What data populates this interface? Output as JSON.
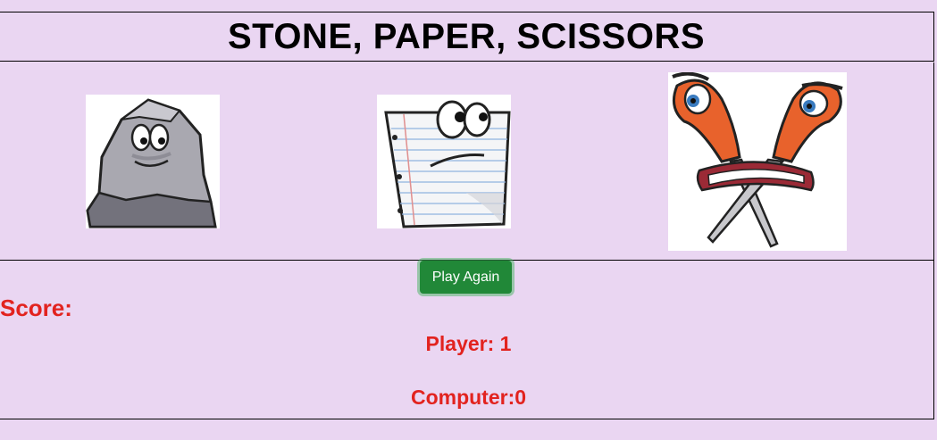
{
  "title": "STONE, PAPER, SCISSORS",
  "choices": [
    {
      "id": "stone",
      "alt": "stone"
    },
    {
      "id": "paper",
      "alt": "paper"
    },
    {
      "id": "scissors",
      "alt": "scissors"
    }
  ],
  "play_again_label": "Play Again",
  "score": {
    "label": "Score:",
    "player": "Player: 1",
    "computer": "Computer:0"
  },
  "colors": {
    "background": "#ead6f2",
    "score_text": "#e2231f",
    "button": "#218838"
  }
}
